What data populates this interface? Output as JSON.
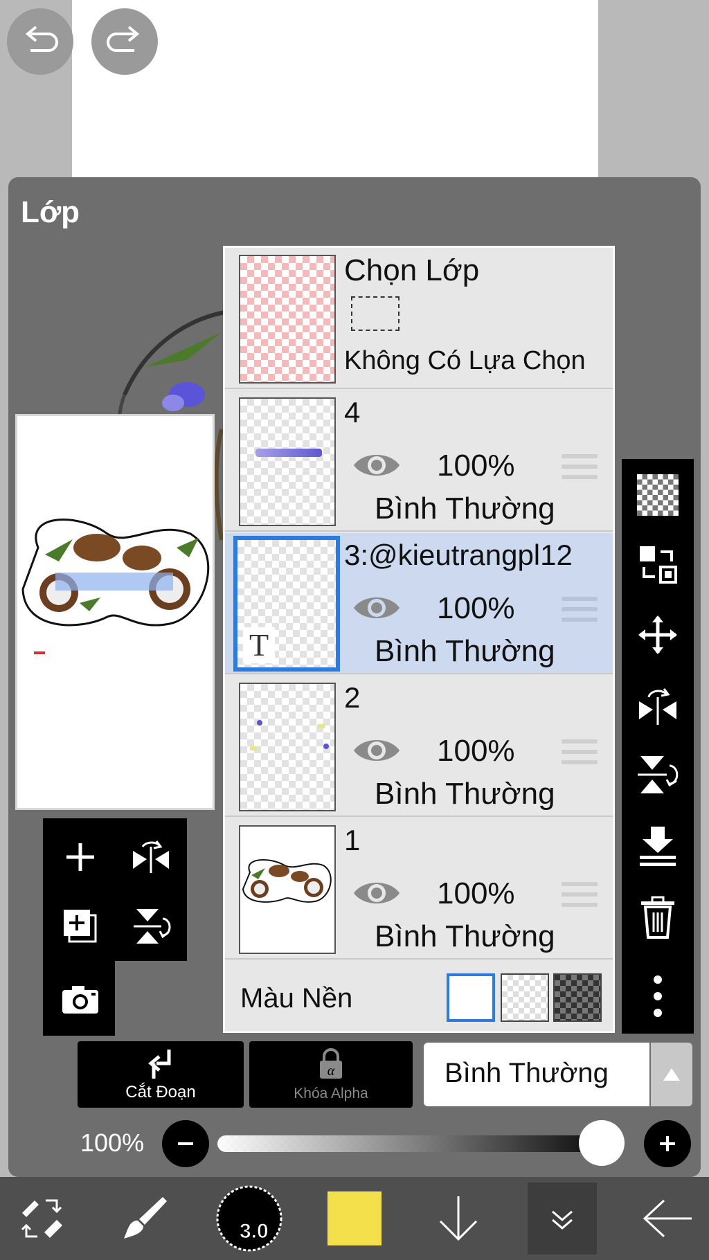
{
  "panel": {
    "title": "Lớp"
  },
  "selection_layer": {
    "title": "Chọn Lớp",
    "subtitle": "Không Có Lựa Chọn"
  },
  "layers": [
    {
      "name": "4",
      "opacity": "100%",
      "blend": "Bình Thường",
      "selected": false
    },
    {
      "name": "3:@kieutrangpl12",
      "opacity": "100%",
      "blend": "Bình Thường",
      "selected": true
    },
    {
      "name": "2",
      "opacity": "100%",
      "blend": "Bình Thường",
      "selected": false
    },
    {
      "name": "1",
      "opacity": "100%",
      "blend": "Bình Thường",
      "selected": false
    }
  ],
  "background": {
    "label": "Màu Nền",
    "selected": "white"
  },
  "buttons": {
    "clipping": "Cắt Đoạn",
    "alpha_lock": "Khóa Alpha"
  },
  "blend_mode": {
    "value": "Bình Thường"
  },
  "layer_opacity": {
    "label": "100%",
    "value": 1.0
  },
  "brush": {
    "size": "3.0"
  },
  "colors": {
    "current": "#f3e04a",
    "selection_accent": "#2e7be0",
    "selected_row": "#cdd9ee"
  }
}
